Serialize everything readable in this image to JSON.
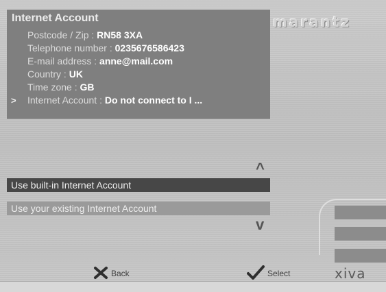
{
  "brand": {
    "logo": "marantz",
    "footer_logo": "xiva"
  },
  "panel": {
    "title": "Internet Account",
    "rows": [
      {
        "label": "Postcode / Zip : ",
        "value": "RN58 3XA"
      },
      {
        "label": "Telephone number : ",
        "value": "0235676586423"
      },
      {
        "label": "E-mail address : ",
        "value": "anne@mail.com"
      },
      {
        "label": "Country : ",
        "value": "UK"
      },
      {
        "label": "Time zone : ",
        "value": "GB"
      },
      {
        "label": "Internet Account : ",
        "value": "Do not connect to I ...",
        "marker": ">"
      }
    ]
  },
  "options": [
    {
      "label": "Use built-in Internet Account",
      "selected": true
    },
    {
      "label": "Use your existing Internet Account",
      "selected": false
    }
  ],
  "footer": {
    "back_label": "Back",
    "select_label": "Select"
  },
  "icons": {
    "up": "^",
    "down": "v"
  },
  "colors": {
    "selected_bg": "#474747",
    "panel_bg": "#7f7f7f",
    "option_bg": "#9a9a9a"
  }
}
